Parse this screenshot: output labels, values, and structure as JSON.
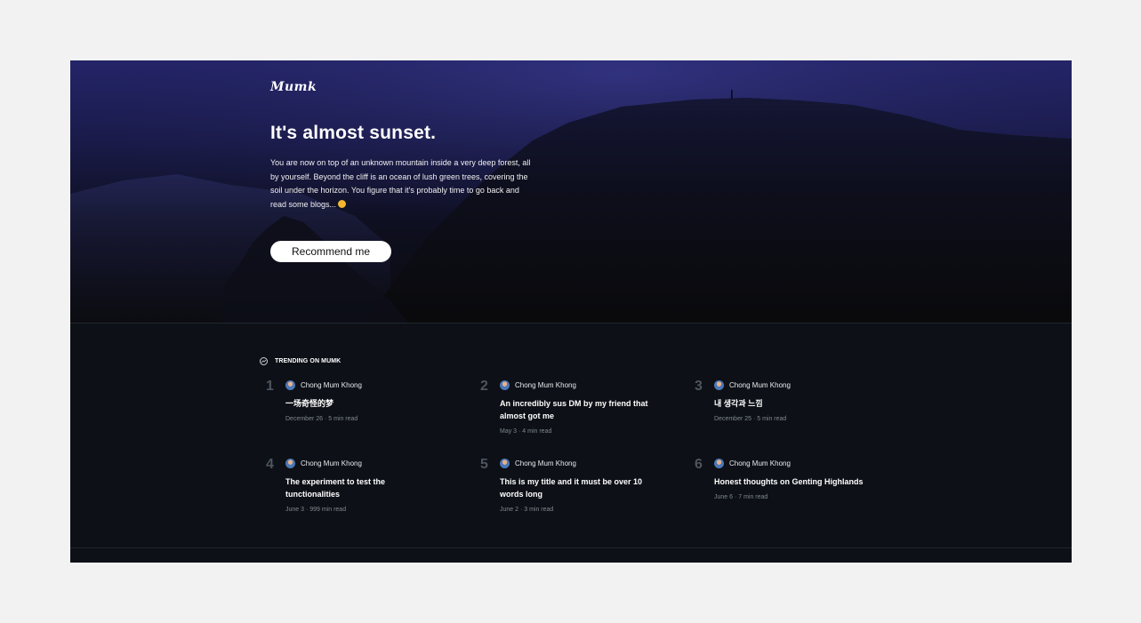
{
  "hero": {
    "logo": "Mumk",
    "title": "It's almost sunset.",
    "description": "You are now on top of an unknown mountain inside a very deep forest, all by yourself. Beyond the cliff is an ocean of lush green trees, covering the soil under the horizon. You figure that it's probably time to go back and read some blogs...",
    "emoji_icon": "grinning-face-emoji",
    "button_label": "Recommend me"
  },
  "trending": {
    "icon": "trending-up-icon",
    "label": "TRENDING ON MUMK",
    "items": [
      {
        "rank": "1",
        "author": "Chong Mum Khong",
        "title": "一场奇怪的梦",
        "meta": "December 26 · 5 min read"
      },
      {
        "rank": "2",
        "author": "Chong Mum Khong",
        "title": "An incredibly sus DM by my friend that almost got me",
        "meta": "May 3 · 4 min read"
      },
      {
        "rank": "3",
        "author": "Chong Mum Khong",
        "title": "내 생각과 느낌",
        "meta": "December 25 · 5 min read"
      },
      {
        "rank": "4",
        "author": "Chong Mum Khong",
        "title": "The experiment to test the tunctionalities",
        "meta": "June 3 · 999 min read"
      },
      {
        "rank": "5",
        "author": "Chong Mum Khong",
        "title": "This is my title and it must be over 10 words long",
        "meta": "June 2 · 3 min read"
      },
      {
        "rank": "6",
        "author": "Chong Mum Khong",
        "title": "Honest thoughts on Genting Highlands",
        "meta": "June 6 · 7 min read"
      }
    ]
  },
  "colors": {
    "page_background": "#f2f2f2",
    "hero_sky": "#24246a",
    "section_background": "#0d1016",
    "button_background": "#ffffff",
    "rank_number": "#4d5560",
    "meta_text": "#7f8893"
  }
}
